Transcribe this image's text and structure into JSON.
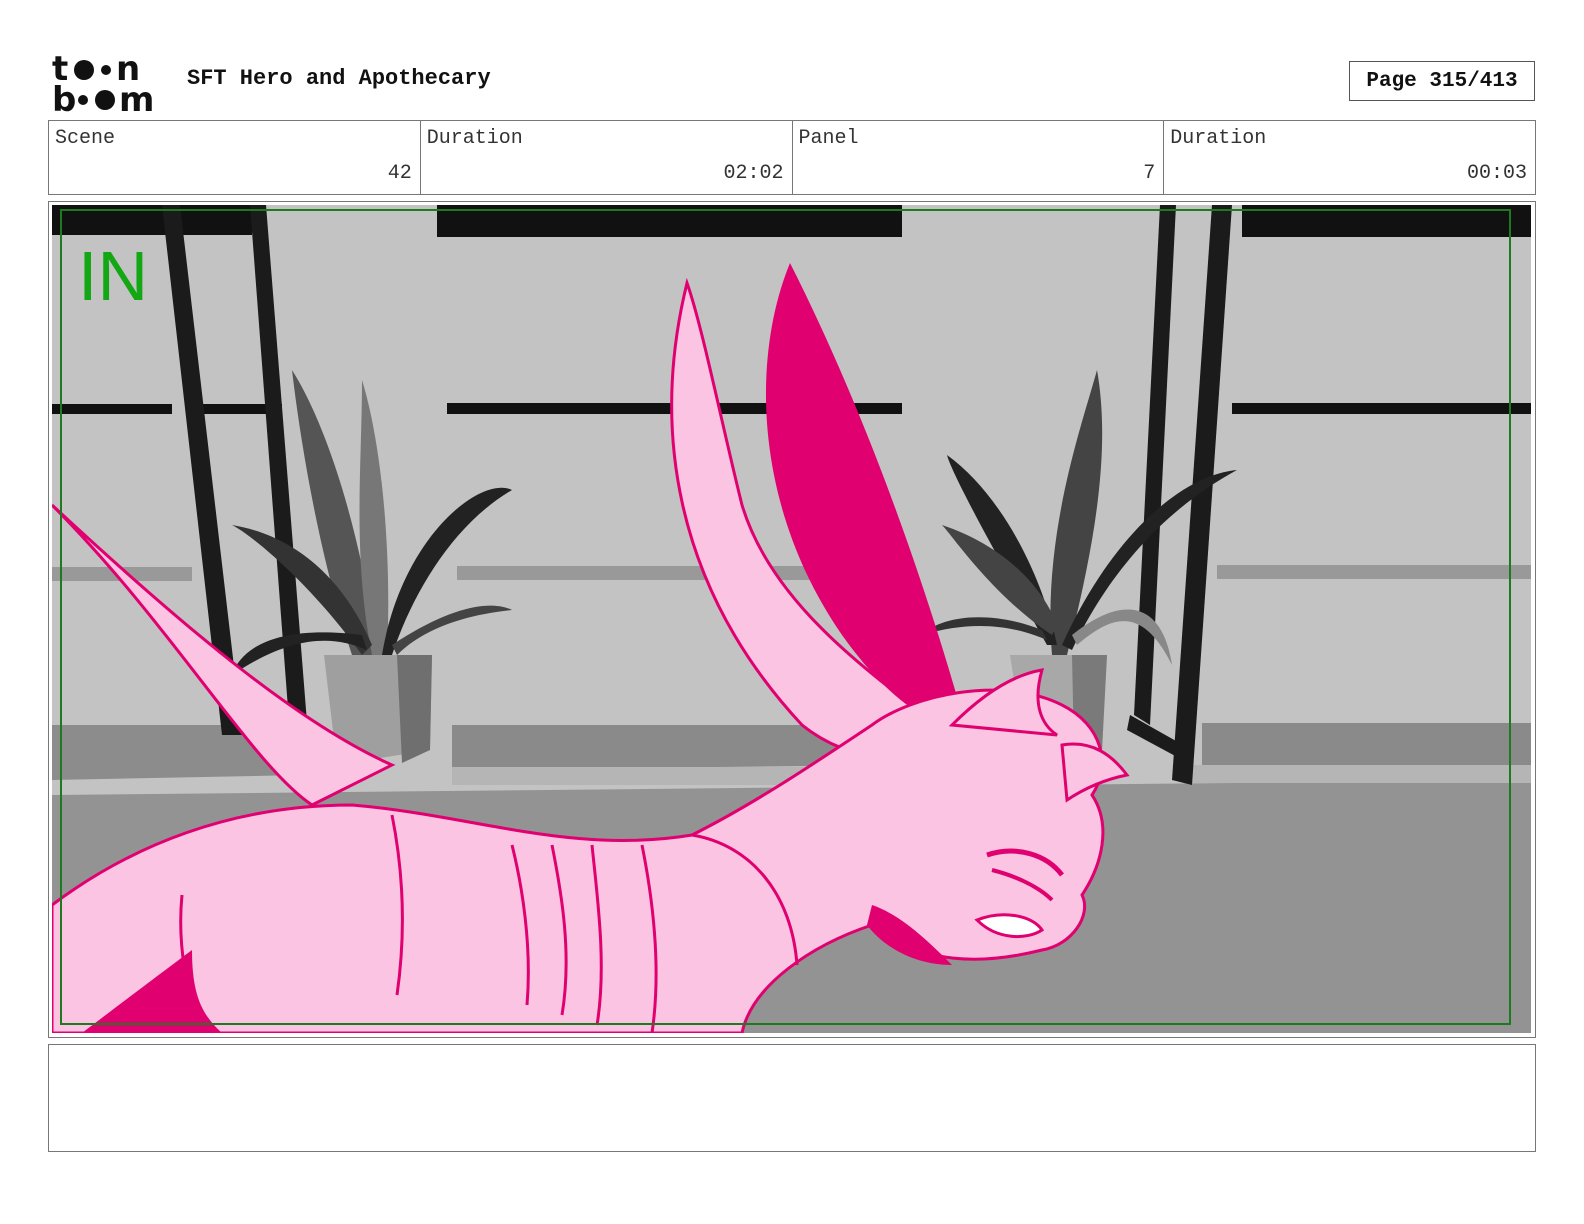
{
  "header": {
    "logo_text": "toonboom",
    "project_title": "SFT Hero and Apothecary",
    "page_label": "Page 315/413"
  },
  "info": [
    {
      "label": "Scene",
      "value": "42"
    },
    {
      "label": "Duration",
      "value": "02:02"
    },
    {
      "label": "Panel",
      "value": "7"
    },
    {
      "label": "Duration",
      "value": "00:03"
    }
  ],
  "panel": {
    "marker_text": "IN",
    "colors": {
      "wall": "#c3c3c3",
      "floor": "#939393",
      "shelf": "#1d1d1d",
      "character_fill": "#fbc4e2",
      "character_line": "#e0006f",
      "safe_frame": "#1e7a1e",
      "marker": "#13a813"
    }
  },
  "notes": {
    "text": ""
  }
}
